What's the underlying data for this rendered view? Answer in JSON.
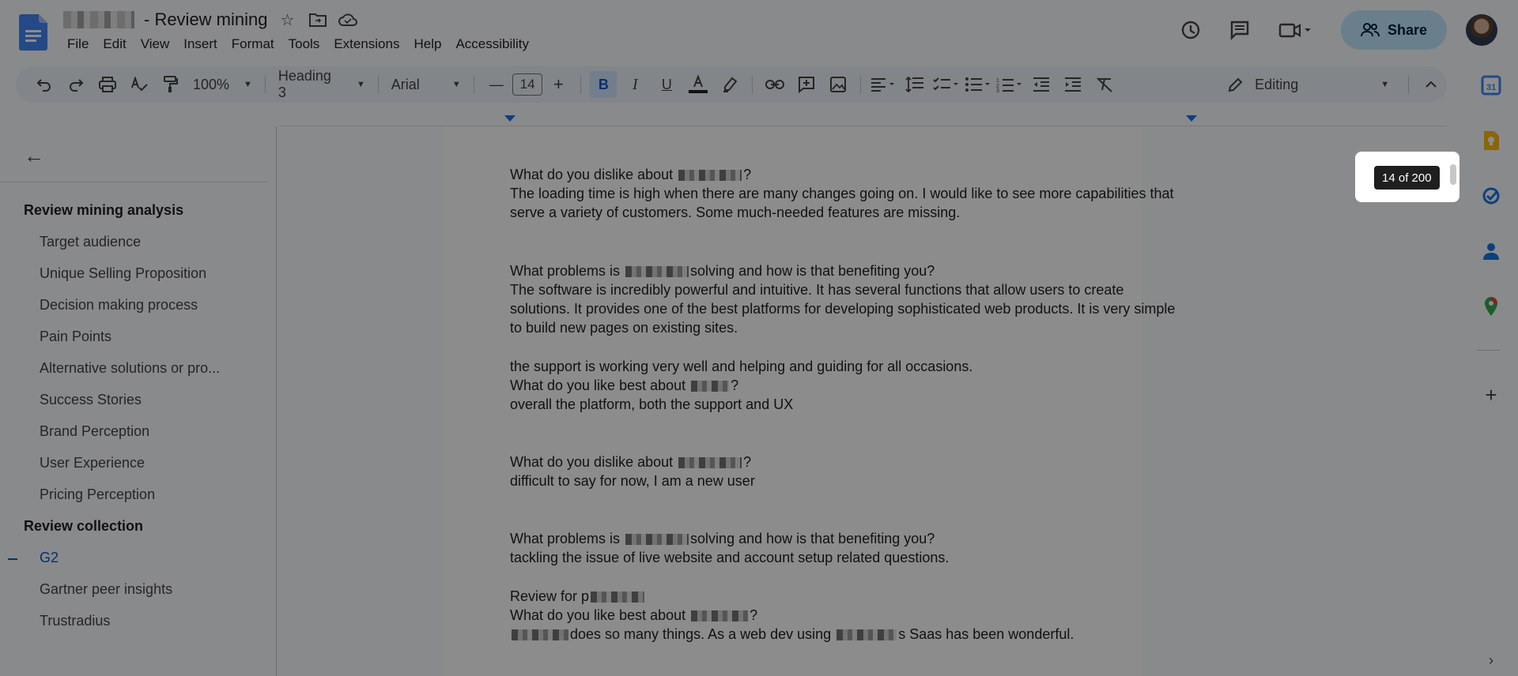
{
  "header": {
    "doc_title": "- Review mining",
    "menu": [
      "File",
      "Edit",
      "View",
      "Insert",
      "Format",
      "Tools",
      "Extensions",
      "Help",
      "Accessibility"
    ],
    "share_label": "Share"
  },
  "toolbar": {
    "zoom": "100%",
    "style": "Heading 3",
    "font": "Arial",
    "font_size": "14",
    "bold": "B",
    "italic": "I",
    "underline": "U",
    "mode": "Editing"
  },
  "outline": {
    "items": [
      {
        "label": "Review mining analysis",
        "level": "h2"
      },
      {
        "label": "Target audience",
        "level": "h3"
      },
      {
        "label": "Unique Selling Proposition",
        "level": "h3"
      },
      {
        "label": "Decision making process",
        "level": "h3"
      },
      {
        "label": "Pain Points",
        "level": "h3"
      },
      {
        "label": "Alternative solutions or pro...",
        "level": "h3"
      },
      {
        "label": "Success Stories",
        "level": "h3"
      },
      {
        "label": "Brand Perception",
        "level": "h3"
      },
      {
        "label": "User Experience",
        "level": "h3"
      },
      {
        "label": "Pricing Perception",
        "level": "h3"
      },
      {
        "label": "Review collection",
        "level": "h2"
      },
      {
        "label": "G2",
        "level": "h3",
        "active": true
      },
      {
        "label": "Gartner peer insights",
        "level": "h3"
      },
      {
        "label": "Trustradius",
        "level": "h3"
      }
    ]
  },
  "document": {
    "lines": [
      {
        "pre": "What do you dislike about ",
        "post": "?"
      },
      {
        "text": "The loading time is high when there are many changes going on. I would like to see more capabilities that"
      },
      {
        "text": "serve a variety of customers. Some much-needed features are missing."
      },
      {
        "pre": "What problems is ",
        "post": "solving and how is that benefiting you?"
      },
      {
        "text": "The software is incredibly powerful and intuitive. It has several functions that allow users to create"
      },
      {
        "text": "solutions. It provides one of the best platforms for developing sophisticated web products. It is very simple"
      },
      {
        "text": "to build new pages on existing sites."
      },
      {
        "text": "the support is working very well and helping and guiding for all occasions."
      },
      {
        "pre": "What do you like best about ",
        "post": "?"
      },
      {
        "text": "overall the platform, both the support and UX"
      },
      {
        "pre": "What do you dislike about ",
        "post": "?"
      },
      {
        "text": "difficult to say for now, I am a new user"
      },
      {
        "pre": "What problems is ",
        "post": "solving and how is that benefiting you?"
      },
      {
        "text": "tackling the issue of live website and account setup related questions."
      },
      {
        "pre": "Review for p",
        "post": ""
      },
      {
        "pre": "What do you like best about ",
        "post": "?"
      },
      {
        "pre": "",
        "post": "does so many things. As a web dev using ",
        "post2": "s Saas has been wonderful."
      }
    ]
  },
  "page_indicator": "14 of 200",
  "colors": {
    "accent": "#0b57d0",
    "share_bg": "#c2e7ff",
    "toolbar_bg": "#edf2fa"
  }
}
